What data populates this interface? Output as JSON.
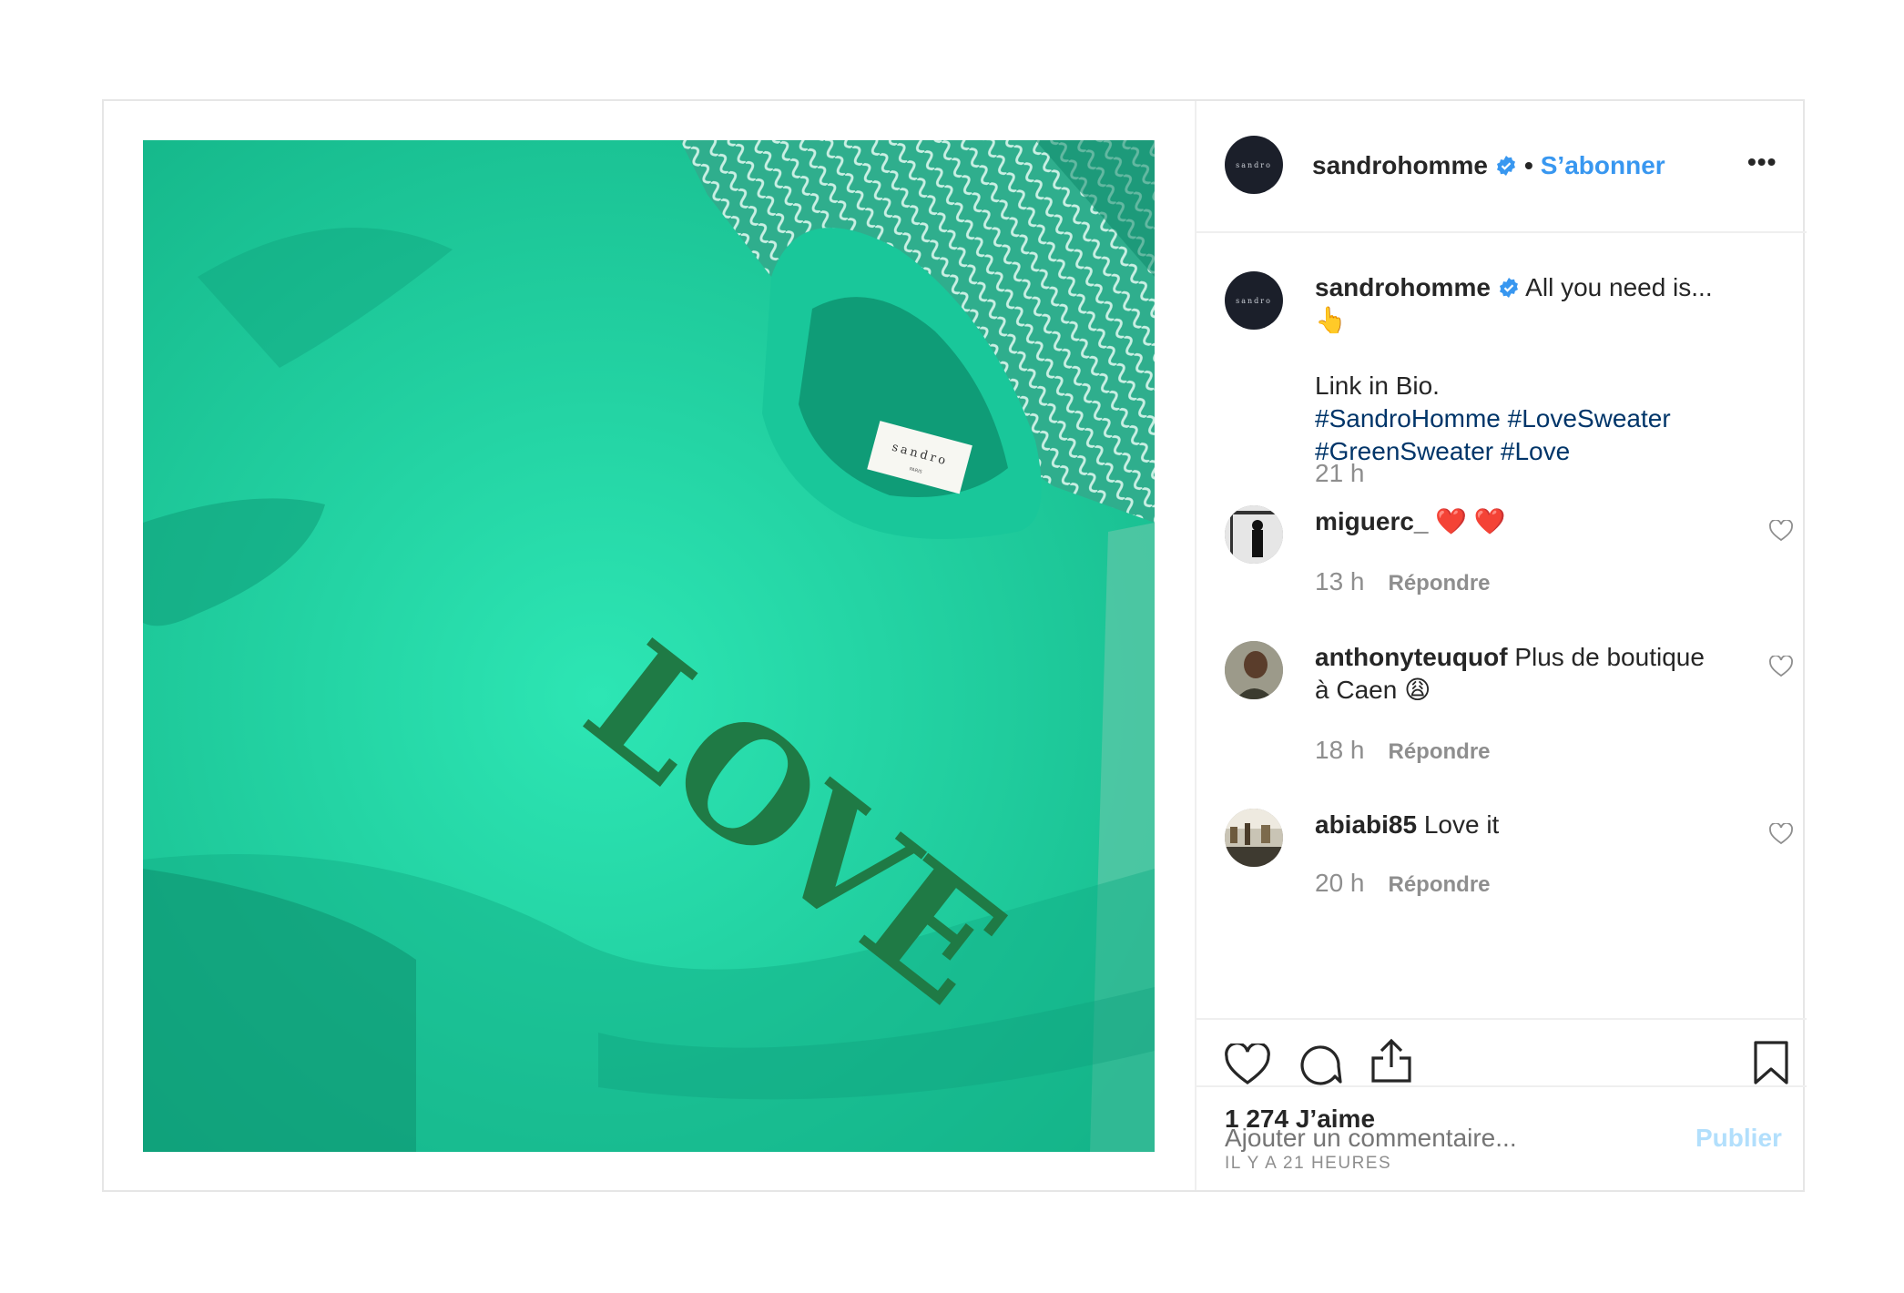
{
  "post": {
    "image": {
      "description_colors": {
        "sweater": "#1fd6a3",
        "print": "#1f7a45"
      },
      "print_text": "LOVE",
      "label_text": "sandro",
      "label_subtext": "PARIS"
    },
    "header": {
      "avatar_text": "sandro",
      "username": "sandrohomme",
      "separator": "•",
      "follow_label": "S’abonner",
      "more_icon": "more-icon",
      "more_glyph": "•••"
    },
    "caption": {
      "username": "sandrohomme",
      "text": "All you need is...",
      "emoji": "👆",
      "line2": "Link in Bio.",
      "hashtags_line1": "#SandroHomme #LoveSweater",
      "hashtags_line2": "#GreenSweater #Love",
      "time": "21 h"
    },
    "comments": [
      {
        "username": "miguerc_",
        "text": "❤️ ❤️",
        "time": "13 h",
        "reply": "Répondre"
      },
      {
        "username": "anthonyteuquof",
        "text": "Plus de boutique",
        "text2": "à Caen 😩",
        "time": "18 h",
        "reply": "Répondre"
      },
      {
        "username": "abiabi85",
        "text": "Love it",
        "time": "20 h",
        "reply": "Répondre"
      }
    ],
    "actions": {
      "icons": [
        "heart-icon",
        "comment-icon",
        "share-icon",
        "bookmark-icon"
      ],
      "likes": "1 274 J’aime",
      "timestamp": "IL Y A 21 HEURES"
    },
    "add_comment": {
      "placeholder": "Ajouter un commentaire...",
      "publish": "Publier"
    },
    "colors": {
      "link_blue": "#3897f0",
      "hashtag": "#003569",
      "muted": "#8e8e8e",
      "publish_disabled": "#b2dffc"
    }
  }
}
